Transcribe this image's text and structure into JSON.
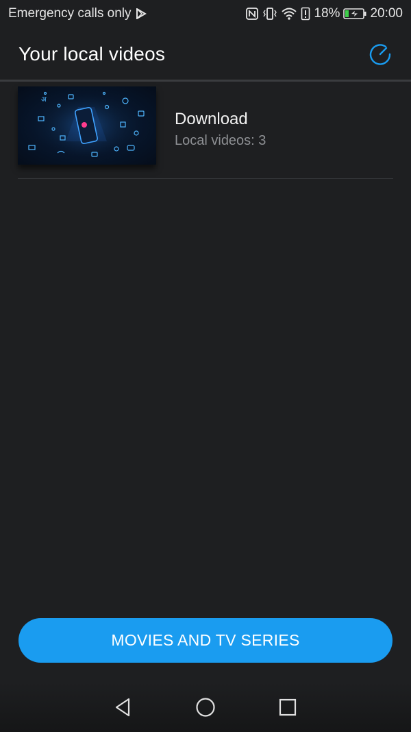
{
  "status_bar": {
    "carrier_text": "Emergency calls only",
    "battery_percent": "18%",
    "time": "20:00",
    "icons": [
      "play-store-icon",
      "nfc-icon",
      "vibrate-icon",
      "wifi-icon",
      "alert-icon",
      "battery-charging-icon"
    ]
  },
  "app_bar": {
    "title": "Your local videos",
    "refresh_icon": "refresh-icon"
  },
  "folders": [
    {
      "name": "Download",
      "count_label": "Local videos: 3"
    }
  ],
  "bottom_button": {
    "label": "MOVIES AND TV SERIES"
  },
  "nav_bar": {
    "icons": [
      "back-icon",
      "home-icon",
      "recents-icon"
    ]
  },
  "colors": {
    "background": "#1e1f21",
    "accent": "#1a9cf0",
    "secondary_text": "#8e9094"
  }
}
